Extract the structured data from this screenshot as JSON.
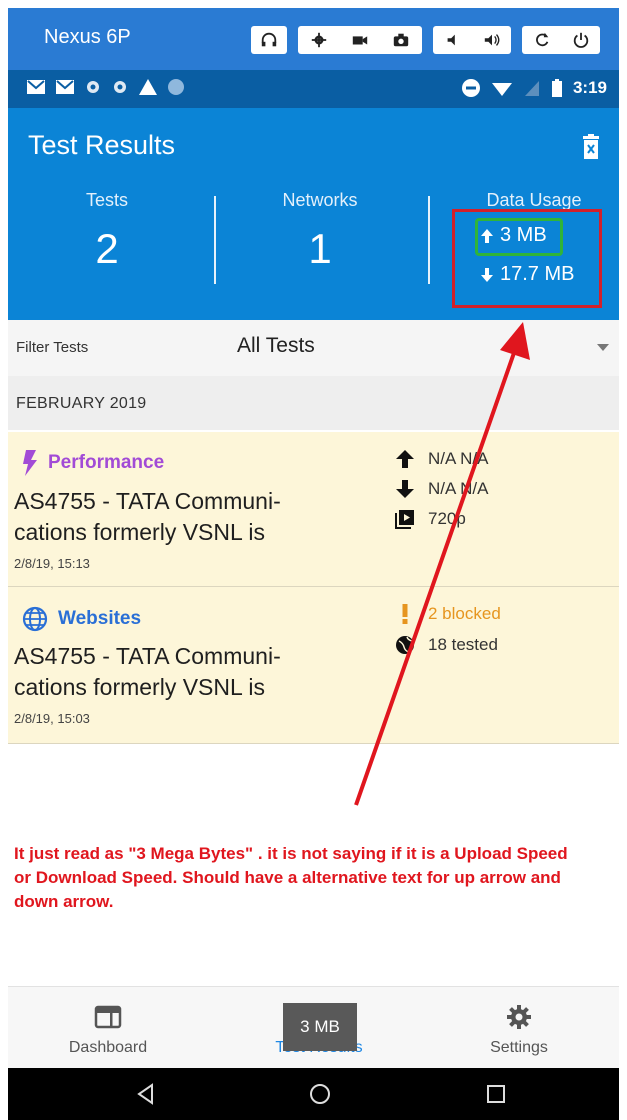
{
  "emulator": {
    "device_name": "Nexus 6P"
  },
  "status_bar": {
    "time": "3:19"
  },
  "header": {
    "title": "Test Results",
    "stats": [
      {
        "label": "Tests",
        "value": "2"
      },
      {
        "label": "Networks",
        "value": "1"
      },
      {
        "label": "Data Usage",
        "upload": "3 MB",
        "download": "17.7 MB"
      }
    ]
  },
  "filter": {
    "label": "Filter Tests",
    "value": "All Tests"
  },
  "month": "FEBRUARY 2019",
  "results": [
    {
      "type": "Performance",
      "type_color": "#a24bd6",
      "title": "AS4755 - TATA Communi-\ncations formerly VSNL is",
      "date": "2/8/19, 15:13",
      "metrics": [
        {
          "icon": "upload-arrow-icon",
          "text": "N/A N/A"
        },
        {
          "icon": "download-arrow-icon",
          "text": "N/A N/A"
        },
        {
          "icon": "video-icon",
          "text": "720p"
        }
      ]
    },
    {
      "type": "Websites",
      "type_color": "#2a6fd6",
      "title": "AS4755 - TATA Communi-\ncations formerly VSNL is",
      "date": "2/8/19, 15:03",
      "metrics": [
        {
          "icon": "exclamation-icon",
          "text": "2 blocked",
          "color": "#e6951f"
        },
        {
          "icon": "globe-icon",
          "text": "18 tested"
        }
      ]
    }
  ],
  "annotation": "It just read as \"3 Mega Bytes\" . it is not saying if it is a Upload Speed or Download Speed. Should have a alternative text for up arrow and down arrow.",
  "bottom_nav": [
    {
      "label": "Dashboard",
      "icon": "dashboard-icon"
    },
    {
      "label": "Test Results",
      "icon": "test-results-icon"
    },
    {
      "label": "Settings",
      "icon": "gear-icon"
    }
  ],
  "tooltip": "3 MB",
  "colors": {
    "header_bg": "#0b84d6",
    "annotation_red": "#e0161e",
    "highlight_green": "#2fb43a",
    "card_bg": "#fdf6d9"
  }
}
